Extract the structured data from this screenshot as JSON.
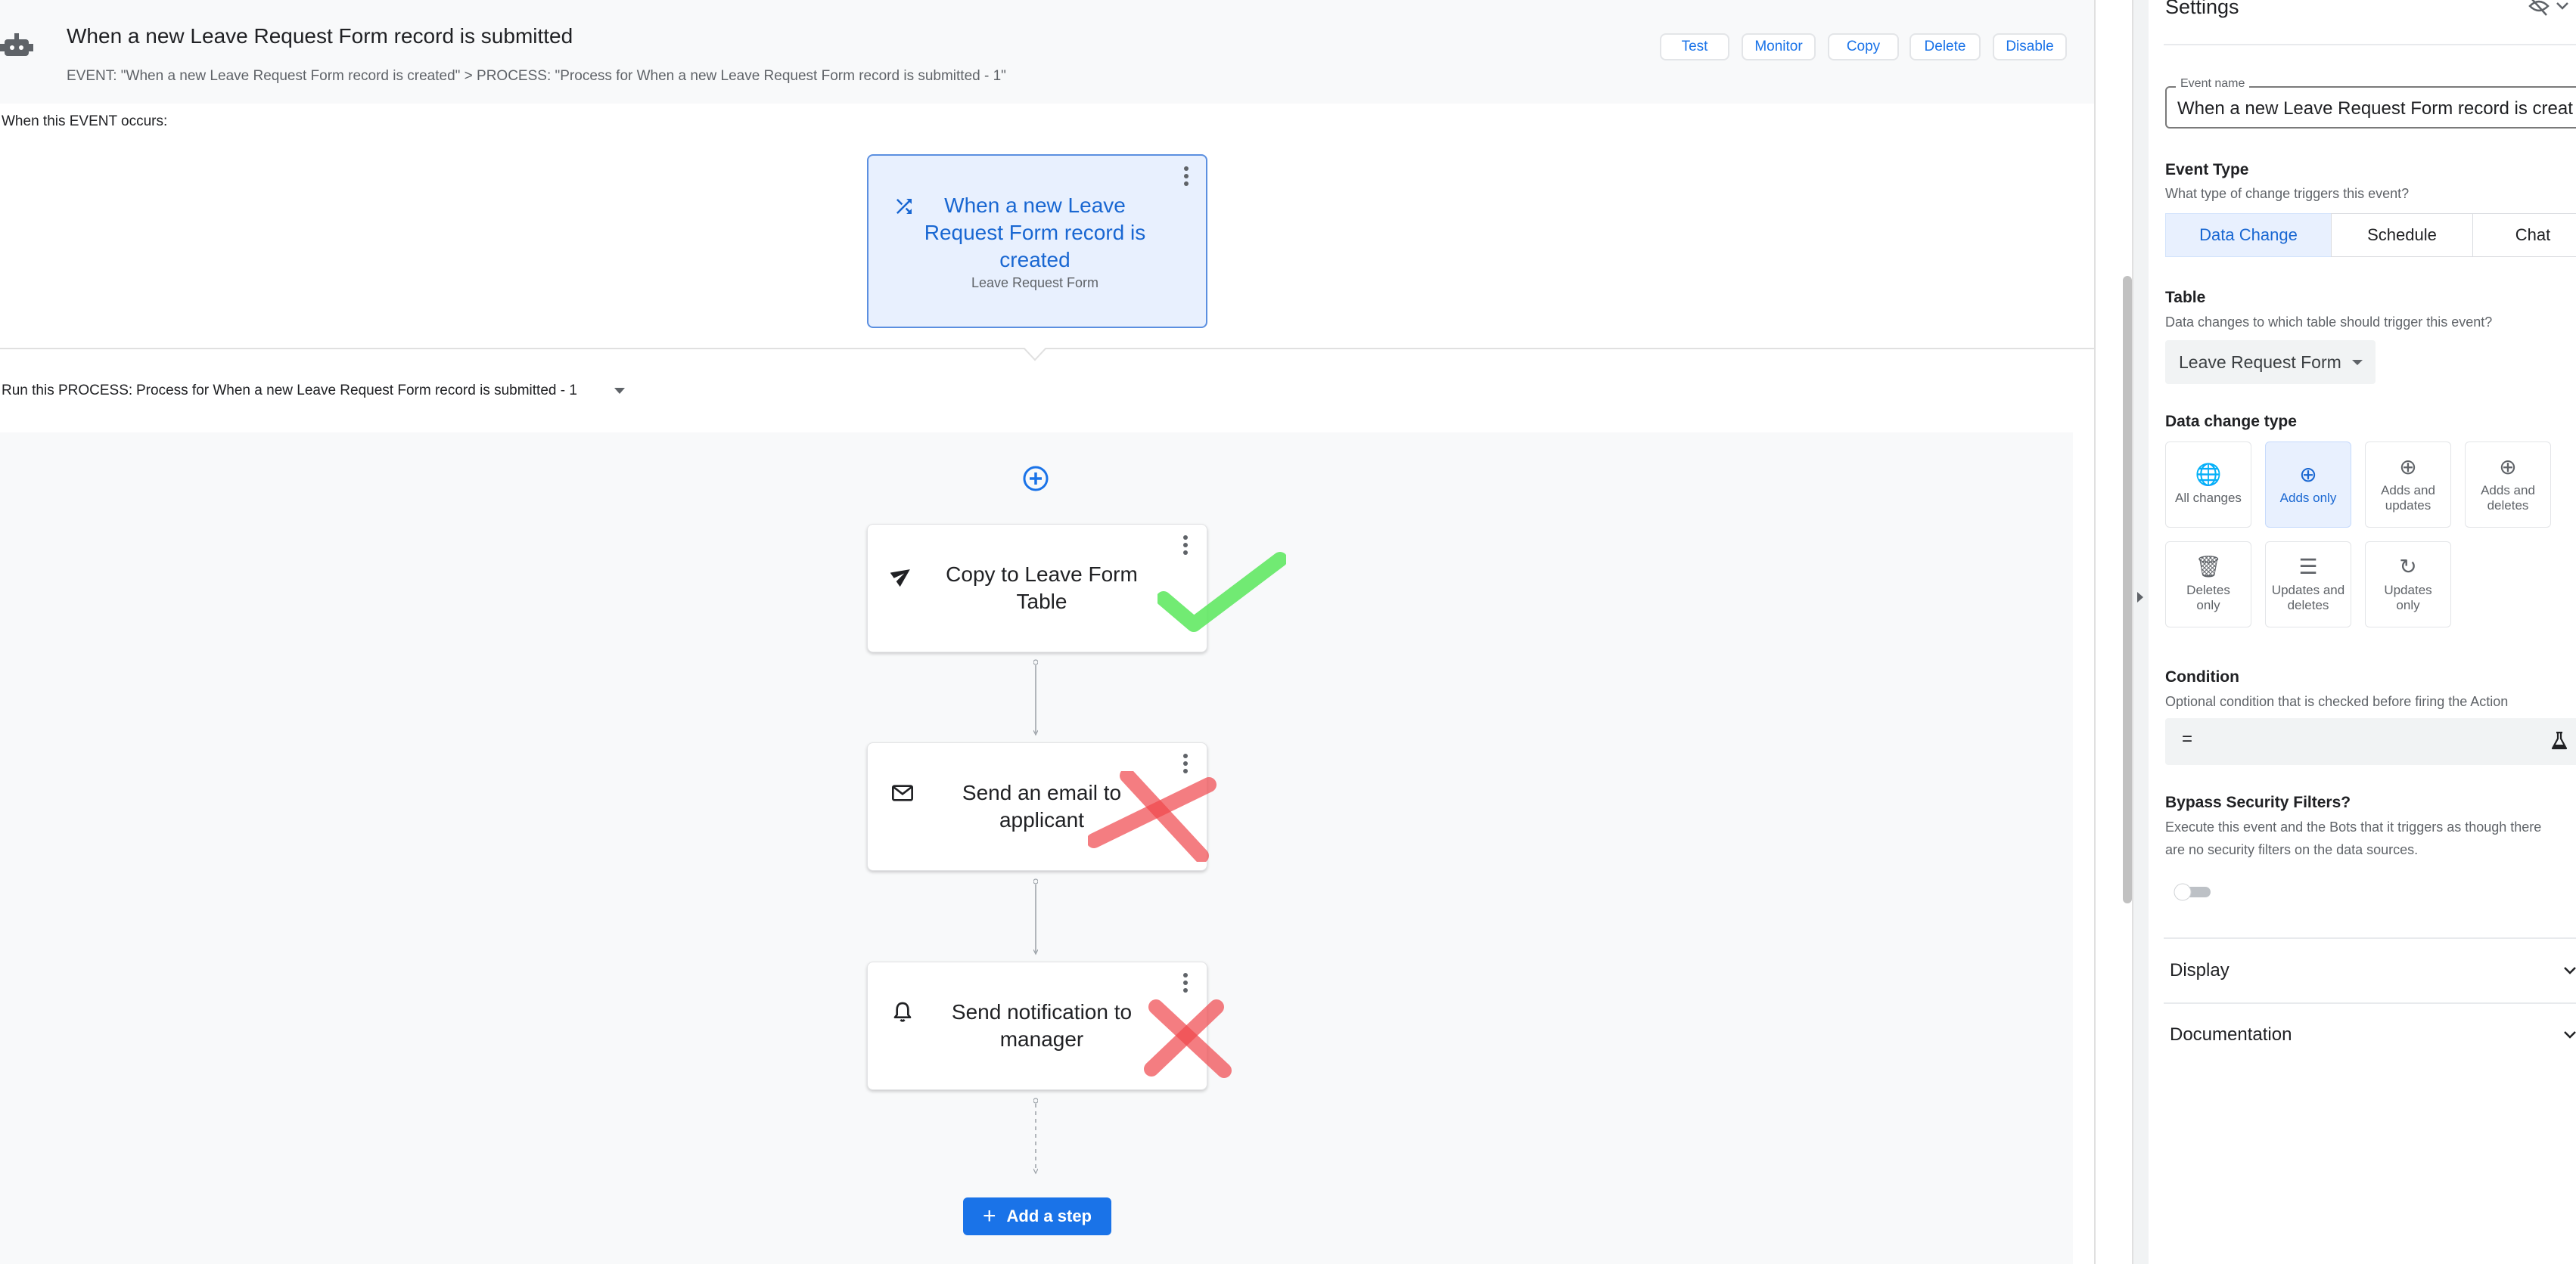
{
  "header": {
    "title": "When a new Leave Request Form record is submitted",
    "breadcrumb": "EVENT: \"When a new Leave Request Form record is created\" > PROCESS: \"Process for When a new Leave Request Form record is submitted - 1\"",
    "buttons": {
      "test": "Test",
      "monitor": "Monitor",
      "copy": "Copy",
      "delete": "Delete",
      "disable": "Disable"
    }
  },
  "event": {
    "section_label": "When this EVENT occurs:",
    "card_title": "When a new Leave Request Form record is created",
    "card_subtitle": "Leave Request Form",
    "icon": "shuffle-icon"
  },
  "process": {
    "label": "Run this PROCESS:",
    "name": "Process for When a new Leave Request Form record is submitted - 1"
  },
  "steps": [
    {
      "label": "Copy to Leave Form Table",
      "icon": "send-icon",
      "annotation": "green-check"
    },
    {
      "label": "Send an email to applicant",
      "icon": "email-icon",
      "annotation": "red-x"
    },
    {
      "label": "Send notification to manager",
      "icon": "bell-icon",
      "annotation": "red-x"
    }
  ],
  "add_step_label": "Add a step",
  "settings": {
    "title": "Settings",
    "event_name_label": "Event name",
    "event_name_value": "When a new Leave Request Form record is creat",
    "event_type": {
      "title": "Event Type",
      "subtitle": "What type of change triggers this event?",
      "options": [
        "Data Change",
        "Schedule",
        "Chat"
      ],
      "selected": "Data Change"
    },
    "table": {
      "title": "Table",
      "subtitle": "Data changes to which table should trigger this event?",
      "value": "Leave Request Form"
    },
    "data_change_type": {
      "title": "Data change type",
      "options": [
        {
          "label": "All changes",
          "icon": "globe-icon"
        },
        {
          "label": "Adds only",
          "icon": "add-circle-icon"
        },
        {
          "label": "Adds and updates",
          "icon": "add-update-icon"
        },
        {
          "label": "Adds and deletes",
          "icon": "add-delete-icon"
        },
        {
          "label": "Deletes only",
          "icon": "trash-icon"
        },
        {
          "label": "Updates and deletes",
          "icon": "update-delete-icon"
        },
        {
          "label": "Updates only",
          "icon": "refresh-icon"
        }
      ],
      "selected": "Adds only"
    },
    "condition": {
      "title": "Condition",
      "subtitle": "Optional condition that is checked before firing the Action",
      "value": "="
    },
    "bypass": {
      "title": "Bypass Security Filters?",
      "subtitle_line1": "Execute this event and the Bots that it triggers as though there",
      "subtitle_line2": "are no security filters on the data sources.",
      "enabled": false
    },
    "accordions": [
      "Display",
      "Documentation"
    ]
  },
  "colors": {
    "accent": "#1a73e8",
    "selected_bg": "#e8f0fe",
    "check": "#59e85a",
    "cross": "#f0474c"
  }
}
